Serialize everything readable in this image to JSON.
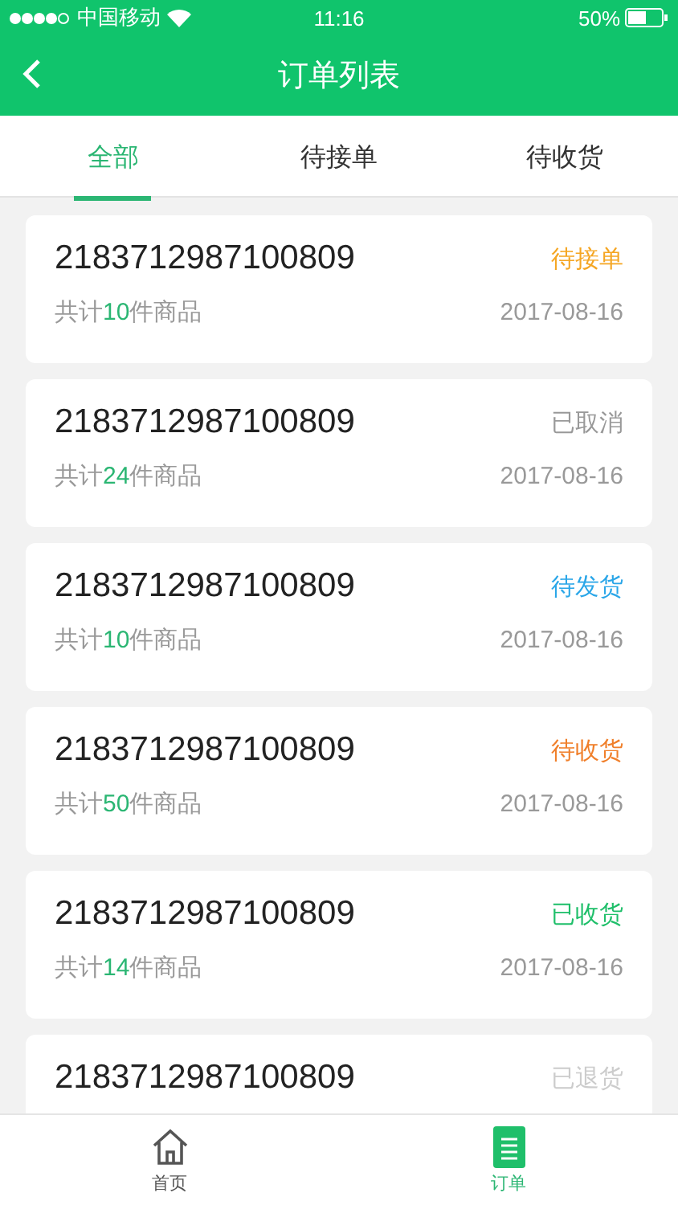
{
  "status_bar": {
    "carrier": "中国移动",
    "time": "11:16",
    "battery": "50%"
  },
  "header": {
    "title": "订单列表"
  },
  "tabs": [
    {
      "label": "全部",
      "selected": true
    },
    {
      "label": "待接单",
      "selected": false
    },
    {
      "label": "待收货",
      "selected": false
    }
  ],
  "orders": [
    {
      "number": "2183712987100809",
      "status": "待接单",
      "color": "#f5a623",
      "count_before": "共计",
      "count": "10",
      "count_after": "件商品",
      "date": "2017-08-16"
    },
    {
      "number": "2183712987100809",
      "status": "已取消",
      "color": "#999999",
      "count_before": "共计",
      "count": "24",
      "count_after": "件商品",
      "date": "2017-08-16"
    },
    {
      "number": "2183712987100809",
      "status": "待发货",
      "color": "#2aa6e8",
      "count_before": "共计",
      "count": "10",
      "count_after": "件商品",
      "date": "2017-08-16"
    },
    {
      "number": "2183712987100809",
      "status": "待收货",
      "color": "#f07f2a",
      "count_before": "共计",
      "count": "50",
      "count_after": "件商品",
      "date": "2017-08-16"
    },
    {
      "number": "2183712987100809",
      "status": "已收货",
      "color": "#1fbf6a",
      "count_before": "共计",
      "count": "14",
      "count_after": "件商品",
      "date": "2017-08-16"
    },
    {
      "number": "2183712987100809",
      "status": "已退货",
      "color": "#cccccc"
    }
  ],
  "bottom_nav": [
    {
      "label": "首页",
      "kind": "home",
      "selected": false
    },
    {
      "label": "订单",
      "kind": "orders",
      "selected": true
    }
  ]
}
